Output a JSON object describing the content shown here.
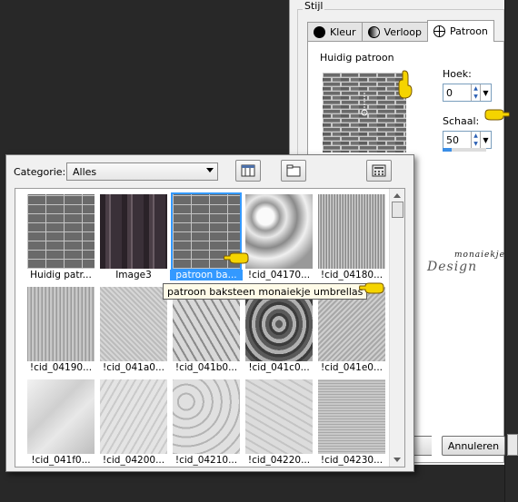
{
  "style_dialog": {
    "group_label": "Stijl",
    "tabs": [
      {
        "label": "Kleur",
        "icon": "black-circle-icon"
      },
      {
        "label": "Verloop",
        "icon": "gradient-circle-icon"
      },
      {
        "label": "Patroon",
        "icon": "globe-icon"
      }
    ],
    "current_pattern_label": "Huidig patroon",
    "angle": {
      "label": "Hoek:",
      "value": "0"
    },
    "scale": {
      "label": "Schaal:",
      "value": "50",
      "progress_fraction": 0.2
    },
    "cancel_label": "Annuleren",
    "logo_text": "Design",
    "logo_small": "monaiekje"
  },
  "pattern_picker": {
    "category_label": "Categorie:",
    "category_value": "Alles",
    "items": [
      {
        "label": "Huidig patr...",
        "texture": "brick"
      },
      {
        "label": "Image3",
        "texture": "columns"
      },
      {
        "label": "patroon ba...",
        "texture": "brick",
        "selected": true
      },
      {
        "label": "!cid_04170...",
        "texture": "swirl"
      },
      {
        "label": "!cid_04180...",
        "texture": "vlines"
      },
      {
        "label": "!cid_04190...",
        "texture": "vlines2"
      },
      {
        "label": "!cid_041a0...",
        "texture": "noise"
      },
      {
        "label": "!cid_041b0...",
        "texture": "cells"
      },
      {
        "label": "!cid_041c0...",
        "texture": "waves"
      },
      {
        "label": "!cid_041e0...",
        "texture": "noise2"
      },
      {
        "label": "!cid_041f0...",
        "texture": "crumple"
      },
      {
        "label": "!cid_04200...",
        "texture": "crumple2"
      },
      {
        "label": "!cid_04210...",
        "texture": "stones"
      },
      {
        "label": "!cid_04220...",
        "texture": "crumple3"
      },
      {
        "label": "!cid_04230...",
        "texture": "weave"
      }
    ],
    "tooltip": "patroon baksteen monaiekje umbrellas"
  },
  "colors": {
    "selection": "#3399ff",
    "hand": "#f5d400"
  }
}
